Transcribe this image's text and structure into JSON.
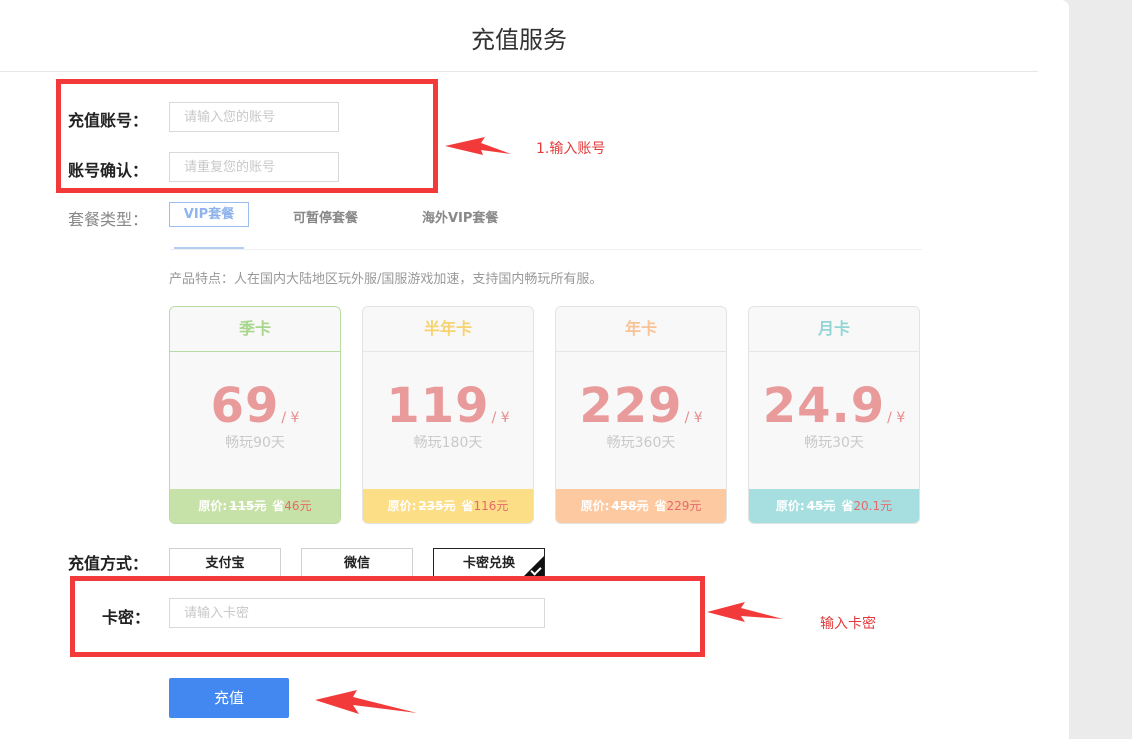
{
  "page": {
    "title": "充值服务"
  },
  "account": {
    "label": "充值账号：",
    "placeholder": "请输入您的账号",
    "confirm_label": "账号确认：",
    "confirm_placeholder": "请重复您的账号"
  },
  "package": {
    "label": "套餐类型：",
    "tabs": [
      "VIP套餐",
      "可暂停套餐",
      "海外VIP套餐"
    ],
    "active_tab": "VIP套餐",
    "features": "产品特点：人在国内大陆地区玩外服/国服游戏加速，支持国内畅玩所有服。"
  },
  "plans": [
    {
      "name": "季卡",
      "price": "69",
      "unit": "/ ¥",
      "days": "畅玩90天",
      "orig_label": "原价:",
      "orig": "115元",
      "save_label": "省",
      "save": "46元",
      "name_color": "#a9d68d",
      "foot_color": "#c7e2a8"
    },
    {
      "name": "半年卡",
      "price": "119",
      "unit": "/ ¥",
      "days": "畅玩180天",
      "orig_label": "原价:",
      "orig": "235元",
      "save_label": "省",
      "save": "116元",
      "name_color": "#f6d36e",
      "foot_color": "#fbde86"
    },
    {
      "name": "年卡",
      "price": "229",
      "unit": "/ ¥",
      "days": "畅玩360天",
      "orig_label": "原价:",
      "orig": "458元",
      "save_label": "省",
      "save": "229元",
      "name_color": "#f8c397",
      "foot_color": "#fdc9a0"
    },
    {
      "name": "月卡",
      "price": "24.9",
      "unit": "/ ¥",
      "days": "畅玩30天",
      "orig_label": "原价:",
      "orig": "45元",
      "save_label": "省",
      "save": "20.1元",
      "name_color": "#93d5d5",
      "foot_color": "#a7dfe0"
    }
  ],
  "payment": {
    "label": "充值方式：",
    "methods": [
      "支付宝",
      "微信",
      "卡密兑换"
    ],
    "selected": "卡密兑换"
  },
  "card_code": {
    "label": "卡密：",
    "placeholder": "请输入卡密"
  },
  "submit": {
    "label": "充值"
  },
  "annotations": {
    "step1": "1.输入账号",
    "step2": "输入卡密",
    "color": "#f23a3a"
  }
}
